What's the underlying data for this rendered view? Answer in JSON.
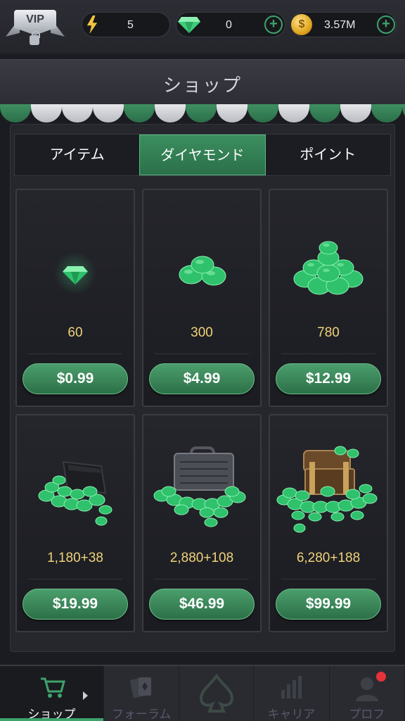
{
  "topbar": {
    "vip_label": "VIP",
    "energy": "5",
    "gems": "0",
    "coins": "3.57M",
    "plus": "+",
    "coin_symbol": "$"
  },
  "header": {
    "title": "ショップ"
  },
  "tabs": [
    {
      "label": "アイテム",
      "active": false
    },
    {
      "label": "ダイヤモンド",
      "active": true
    },
    {
      "label": "ポイント",
      "active": false
    }
  ],
  "products": [
    {
      "amount": "60",
      "price": "$0.99",
      "icon": "single-gem-icon"
    },
    {
      "amount": "300",
      "price": "$4.99",
      "icon": "gem-cluster-small-icon"
    },
    {
      "amount": "780",
      "price": "$12.99",
      "icon": "gem-pile-icon"
    },
    {
      "amount": "1,180+38",
      "price": "$19.99",
      "icon": "gem-wallet-icon"
    },
    {
      "amount": "2,880+108",
      "price": "$46.99",
      "icon": "gem-briefcase-icon"
    },
    {
      "amount": "6,280+188",
      "price": "$99.99",
      "icon": "gem-treasure-chest-icon"
    }
  ],
  "bottom_nav": [
    {
      "label": "ショップ",
      "icon": "cart-icon",
      "active": true
    },
    {
      "label": "フォーラム",
      "icon": "cards-icon",
      "active": false
    },
    {
      "label": "",
      "icon": "spade-logo-icon",
      "active": false
    },
    {
      "label": "キャリア",
      "icon": "bar-chart-icon",
      "active": false
    },
    {
      "label": "プロフ",
      "icon": "profile-icon",
      "active": false
    }
  ],
  "colors": {
    "accent_green": "#3ea36b",
    "amount_gold": "#f0d27a",
    "notification_red": "#e8323a"
  }
}
